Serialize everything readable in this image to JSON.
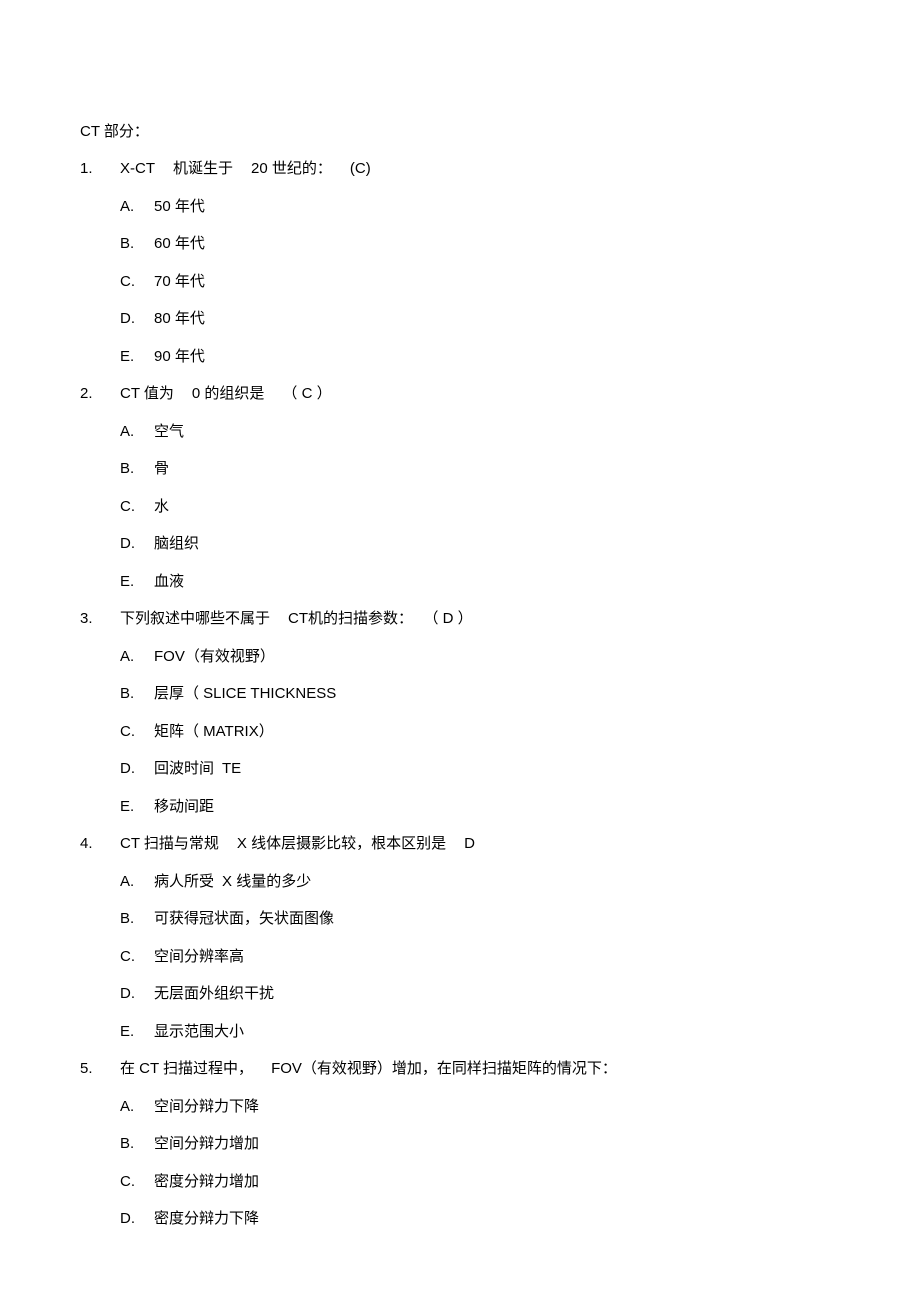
{
  "section_title": "CT 部分：",
  "questions": [
    {
      "number": "1.",
      "parts": [
        "X-CT",
        "机诞生于",
        "20 世纪的：",
        "(C)"
      ],
      "options": [
        {
          "letter": "A.",
          "parts": [
            "50 年代"
          ]
        },
        {
          "letter": "B.",
          "parts": [
            "60 年代"
          ]
        },
        {
          "letter": "C.",
          "parts": [
            "70 年代"
          ]
        },
        {
          "letter": "D.",
          "parts": [
            "80 年代"
          ]
        },
        {
          "letter": "E.",
          "parts": [
            "90 年代"
          ]
        }
      ]
    },
    {
      "number": "2.",
      "parts": [
        "CT 值为",
        "0 的组织是",
        "（ C ）"
      ],
      "options": [
        {
          "letter": "A.",
          "parts": [
            "空气"
          ]
        },
        {
          "letter": "B.",
          "parts": [
            "骨"
          ]
        },
        {
          "letter": "C.",
          "parts": [
            "水"
          ]
        },
        {
          "letter": "D.",
          "parts": [
            "脑组织"
          ]
        },
        {
          "letter": "E.",
          "parts": [
            "血液"
          ]
        }
      ]
    },
    {
      "number": "3.",
      "parts": [
        "下列叙述中哪些不属于",
        "CT机的扫描参数：",
        "（ D ）"
      ],
      "options": [
        {
          "letter": "A.",
          "parts": [
            "FOV（有效视野）"
          ]
        },
        {
          "letter": "B.",
          "parts": [
            "层厚（ SLICE THICKNESS"
          ]
        },
        {
          "letter": "C.",
          "parts": [
            "矩阵（ MATRIX）"
          ]
        },
        {
          "letter": "D.",
          "parts": [
            "回波时间",
            "TE"
          ]
        },
        {
          "letter": "E.",
          "parts": [
            "移动间距"
          ]
        }
      ]
    },
    {
      "number": "4.",
      "parts": [
        "CT 扫描与常规",
        "X 线体层摄影比较，根本区别是",
        "D"
      ],
      "options": [
        {
          "letter": "A.",
          "parts": [
            "病人所受",
            "X 线量的多少"
          ]
        },
        {
          "letter": "B.",
          "parts": [
            "可获得冠状面，矢状面图像"
          ]
        },
        {
          "letter": "C.",
          "parts": [
            "空间分辨率高"
          ]
        },
        {
          "letter": "D.",
          "parts": [
            "无层面外组织干扰"
          ]
        },
        {
          "letter": "E.",
          "parts": [
            "显示范围大小"
          ]
        }
      ]
    },
    {
      "number": "5.",
      "parts": [
        "在 CT 扫描过程中，",
        "FOV（有效视野）增加，在同样扫描矩阵的情况下："
      ],
      "options": [
        {
          "letter": "A.",
          "parts": [
            "空间分辩力下降"
          ]
        },
        {
          "letter": "B.",
          "parts": [
            "空间分辩力增加"
          ]
        },
        {
          "letter": "C.",
          "parts": [
            "密度分辩力增加"
          ]
        },
        {
          "letter": "D.",
          "parts": [
            "密度分辩力下降"
          ]
        }
      ]
    }
  ]
}
